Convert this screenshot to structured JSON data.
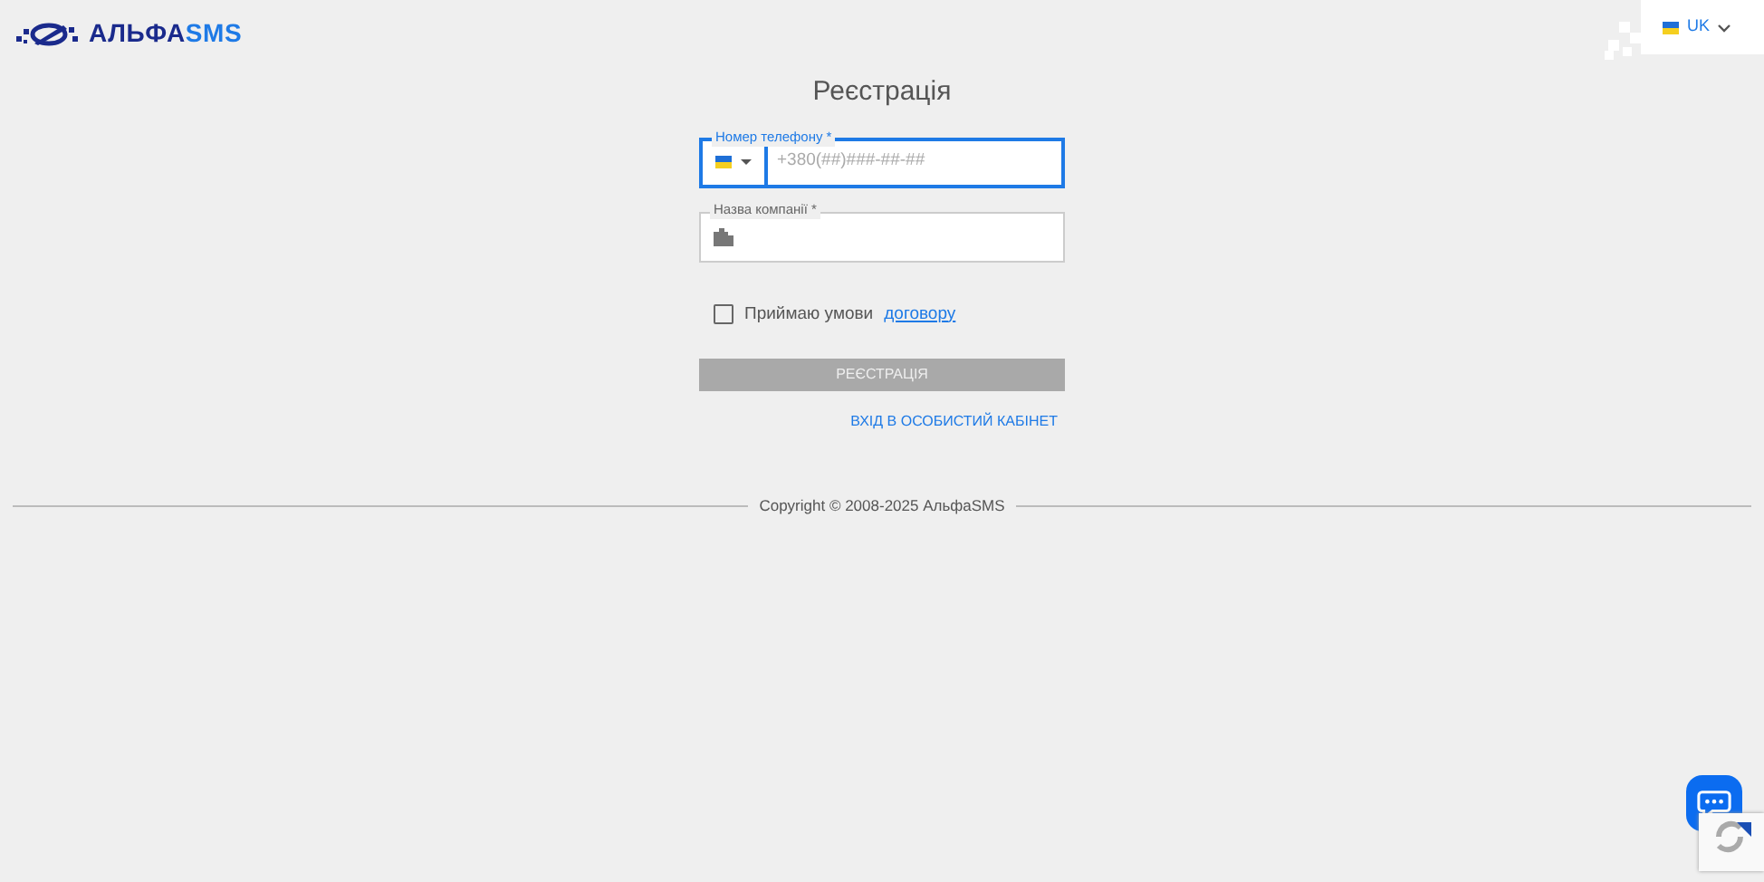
{
  "header": {
    "logo_text": "АЛЬФА",
    "logo_accent": "SMS",
    "language": "UK"
  },
  "form": {
    "title": "Реєстрація",
    "fields": [
      {
        "kind": "phone",
        "label": "Номер телефону *",
        "placeholder": "+380(##)###-##-##",
        "focused": true
      },
      {
        "kind": "company",
        "label": "Назва компанії *",
        "focused": false
      }
    ],
    "agree": {
      "checked": false,
      "text": "Приймаю умови",
      "link": "договору"
    },
    "submit": {
      "label": "РЕЄСТРАЦІЯ",
      "disabled": true
    },
    "login_link": "ВХІД В ОСОБИСТИЙ КАБІНЕТ"
  },
  "footer": {
    "copyright": "Copyright © 2008-2025 АльфаSMS"
  }
}
